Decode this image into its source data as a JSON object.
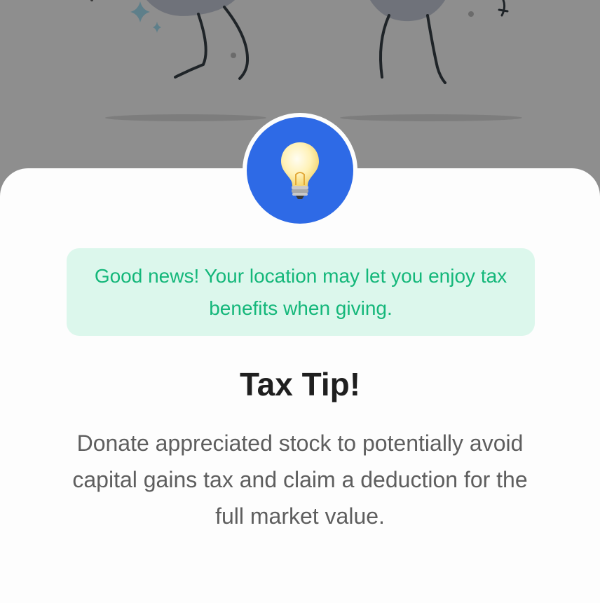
{
  "modal": {
    "icon": "lightbulb-icon",
    "badge_color": "#2e6ae6",
    "banner_text": "Good news! Your location may let you enjoy tax benefits when giving.",
    "banner_text_color": "#14b77a",
    "banner_bg_color": "#dcf7ec",
    "title": "Tax Tip!",
    "body": "Donate appreciated stock to potentially avoid capital gains tax and claim a deduction for the full market value."
  }
}
